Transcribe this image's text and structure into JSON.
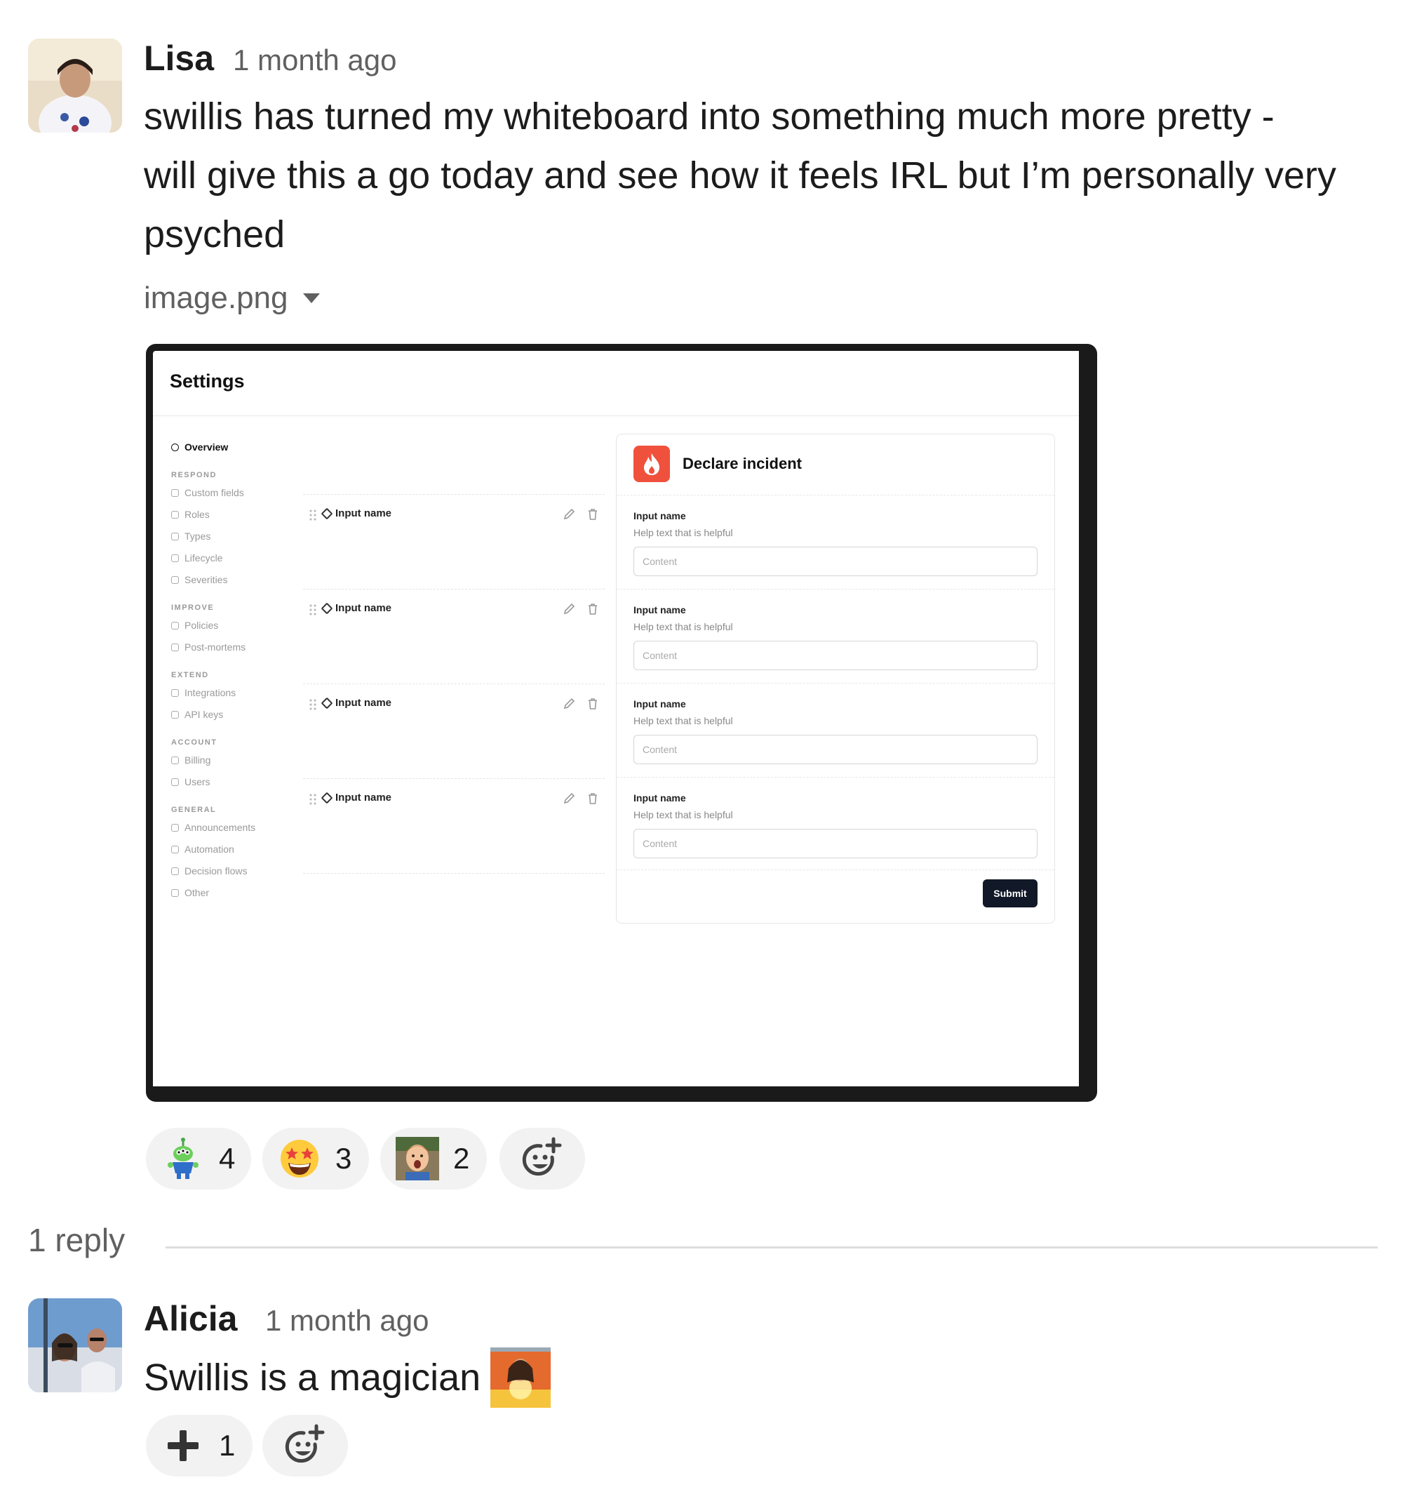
{
  "messages": [
    {
      "author": "Lisa",
      "timestamp": "1 month ago",
      "text_lines": [
        "swillis has turned my whiteboard into something much more pretty -",
        "will give this a go today and see how it feels IRL but I’m personally very",
        "psyched"
      ],
      "attachment": {
        "filename": "image.png",
        "screenshot": {
          "title": "Settings",
          "nav": {
            "overview": "Overview",
            "sections": [
              {
                "heading": "RESPOND",
                "items": [
                  "Custom fields",
                  "Roles",
                  "Types",
                  "Lifecycle",
                  "Severities"
                ]
              },
              {
                "heading": "IMPROVE",
                "items": [
                  "Policies",
                  "Post-mortems"
                ]
              },
              {
                "heading": "EXTEND",
                "items": [
                  "Integrations",
                  "API keys"
                ]
              },
              {
                "heading": "ACCOUNT",
                "items": [
                  "Billing",
                  "Users"
                ]
              },
              {
                "heading": "GENERAL",
                "items": [
                  "Announcements",
                  "Automation",
                  "Decision flows",
                  "Other"
                ]
              }
            ]
          },
          "field_rows": [
            "Input name",
            "Input name",
            "Input name",
            "Input name"
          ],
          "form": {
            "title": "Declare incident",
            "fields": [
              {
                "label": "Input name",
                "help": "Help text that is helpful",
                "placeholder": "Content"
              },
              {
                "label": "Input name",
                "help": "Help text that is helpful",
                "placeholder": "Content"
              },
              {
                "label": "Input name",
                "help": "Help text that is helpful",
                "placeholder": "Content"
              },
              {
                "label": "Input name",
                "help": "Help text that is helpful",
                "placeholder": "Content"
              }
            ],
            "submit_label": "Submit"
          }
        }
      },
      "reactions": [
        {
          "emoji": "alien-toy",
          "count": "4"
        },
        {
          "emoji": "star-struck",
          "count": "3"
        },
        {
          "emoji": "surprised-kid",
          "count": "2"
        }
      ]
    },
    {
      "author": "Alicia",
      "timestamp": "1 month ago",
      "text": "Swillis is a magician",
      "inline_emoji": "magician-image",
      "reactions": [
        {
          "emoji": "plus-one",
          "count": "1"
        }
      ]
    }
  ],
  "thread": {
    "replies_label": "1 reply"
  }
}
